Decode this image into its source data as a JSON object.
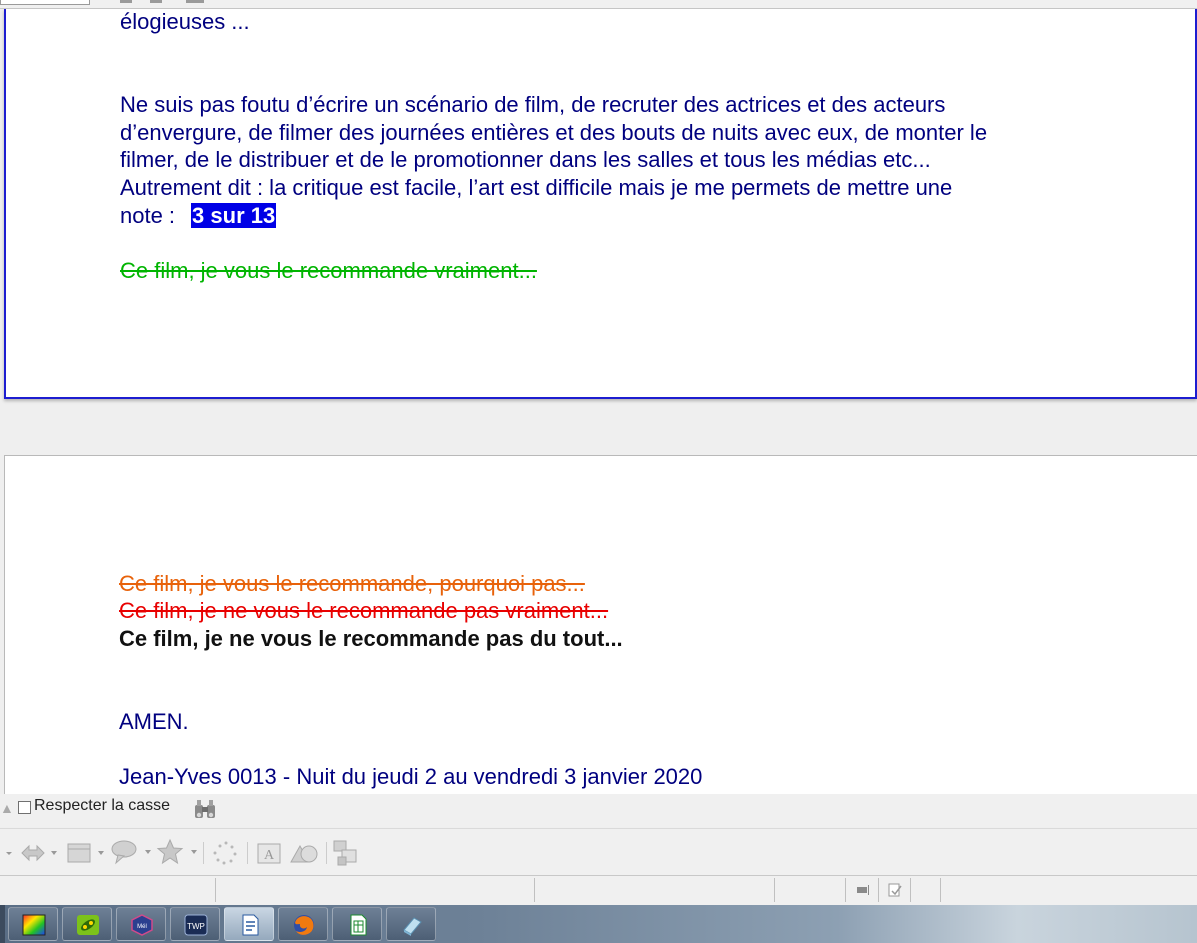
{
  "document": {
    "page1": {
      "line_elogieuses": "élogieuses ...",
      "para_lines": [
        "Ne suis pas foutu d’écrire un scénario de film, de recruter des actrices et des acteurs",
        "d’envergure, de filmer des journées entières et des bouts de nuits avec eux, de monter le",
        "filmer, de le distribuer et de le promotionner dans les salles et tous les médias etc...",
        "Autrement dit : la critique est facile, l’art est difficile mais je me permets de mettre une"
      ],
      "note_label": "note :",
      "note_value": "3 sur 13",
      "recommend_green": "Ce film, je vous le recommande vraiment..."
    },
    "page2": {
      "recommend_orange": "Ce film, je vous le recommande, pourquoi  pas...",
      "recommend_red": "Ce film, je ne vous le recommande pas vraiment...",
      "recommend_bold": "Ce film, je ne vous le recommande pas du tout...",
      "amen": "AMEN.",
      "signature": "Jean-Yves 0013  -  Nuit du jeudi 2 au vendredi 3 janvier 2020"
    }
  },
  "findbar": {
    "match_case_label": "Respecter la casse",
    "match_case_checked": false
  },
  "drawing_toolbar": {
    "tools": [
      "arrow-shapes-icon",
      "basic-shapes-icon",
      "callout-icon",
      "star-icon",
      "points-icon",
      "fontwork-icon",
      "shapes-icon",
      "group-icon"
    ]
  },
  "taskbar": {
    "items": [
      {
        "name": "color-app-icon",
        "label": ""
      },
      {
        "name": "green-app-icon",
        "label": ""
      },
      {
        "name": "mail-app-icon",
        "label": "Mél"
      },
      {
        "name": "twp-app-icon",
        "label": "TWP"
      },
      {
        "name": "writer-app-icon",
        "label": ""
      },
      {
        "name": "firefox-icon",
        "label": ""
      },
      {
        "name": "calc-app-icon",
        "label": ""
      },
      {
        "name": "eraser-app-icon",
        "label": ""
      }
    ]
  },
  "colors": {
    "text_blue": "#00007f",
    "highlight_blue": "#0000e6",
    "green": "#00b400",
    "orange": "#e8620a",
    "red": "#e80000"
  }
}
